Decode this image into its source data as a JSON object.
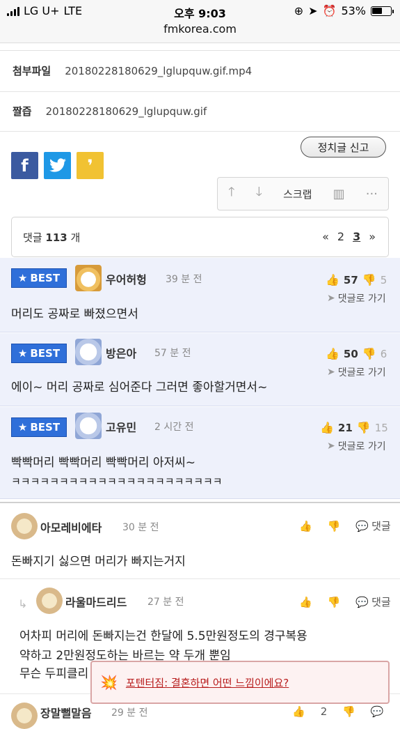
{
  "status_bar": {
    "carrier": "LG U+",
    "network": "LTE",
    "time": "오후 9:03",
    "battery_text": "53%",
    "battery_level": 0.53,
    "url": "fmkorea.com"
  },
  "attachments": {
    "file_label": "첨부파일",
    "file_value": "20180228180629_lglupquw.gif.mp4",
    "thumb_label": "짤즙",
    "thumb_value": "20180228180629_lglupquw.gif"
  },
  "share": {
    "facebook_icon": "f",
    "twitter_icon": "twitter-bird",
    "other_icon": "quote"
  },
  "report_label": "정치글 신고",
  "action_bar": {
    "scrap_label": "스크랩"
  },
  "comments_header": {
    "prefix": "댓글",
    "count": "113",
    "suffix": "개",
    "pages": [
      "2",
      "3"
    ],
    "current_page": "3",
    "first_symbol": "«",
    "next_symbol": "»"
  },
  "best_badge_label": "BEST",
  "goto_label": "댓글로 가기",
  "best_comments": [
    {
      "nickname": "우어허헝",
      "ago": "39 분 전",
      "up": "57",
      "down": "5",
      "text": "머리도 공짜로 빠졌으면서"
    },
    {
      "nickname": "방은아",
      "ago": "57 분 전",
      "up": "50",
      "down": "6",
      "text": "에이~ 머리 공짜로 심어준다 그러면 좋아할거면서~"
    },
    {
      "nickname": "고유민",
      "ago": "2 시간 전",
      "up": "21",
      "down": "15",
      "text": "빡빡머리 빡빡머리 빡빡머리 아저씨~",
      "text2": "ㅋㅋㅋㅋㅋㅋㅋㅋㅋㅋㅋㅋㅋㅋㅋㅋㅋㅋㅋㅋㅋㅋ"
    }
  ],
  "reply_label": "댓글",
  "comments": [
    {
      "nickname": "아모레비에타",
      "ago": "30 분 전",
      "text": "돈빠지기 싫으면 머리가 빠지는거지"
    },
    {
      "nickname": "라울마드리드",
      "ago": "27 분 전",
      "line1": "어차피 머리에 돈빠지는건 한달에 5.5만원정도의 경구복용",
      "line2": "약하고 2만원정도하는 바르는 약 두개 뿐임",
      "line3": "무슨 두피클리"
    },
    {
      "nickname": "장말뻘말음",
      "ago": "29 분 전",
      "up": "2"
    }
  ],
  "popup": {
    "text": "포텐터짐: 결혼하면 어떤 느낌이에요?"
  }
}
